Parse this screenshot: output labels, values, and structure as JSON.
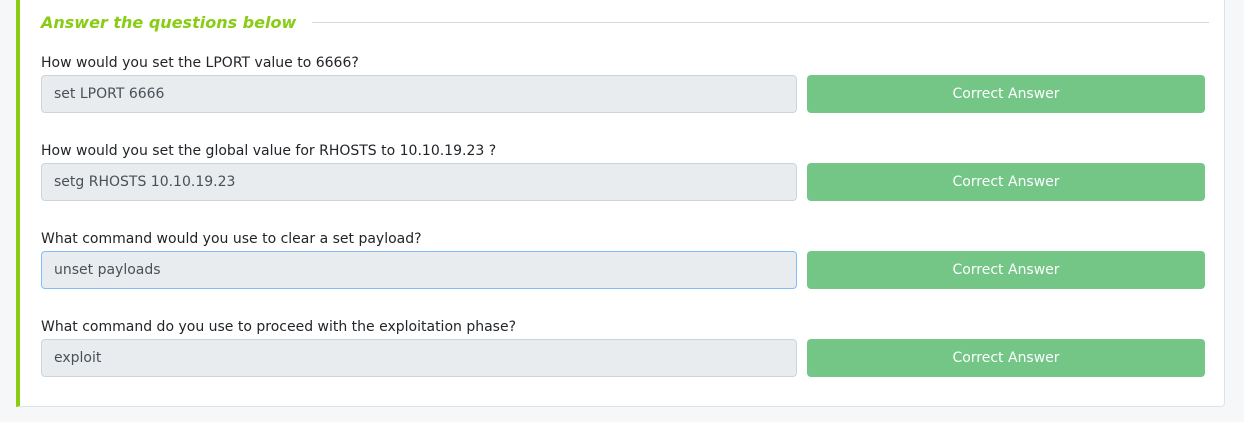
{
  "section": {
    "title": "Answer the questions below"
  },
  "questions": [
    {
      "text": "How would you set the LPORT value to 6666?",
      "answer": "set LPORT 6666",
      "button_label": "Correct Answer"
    },
    {
      "text": "How would you set the global value for RHOSTS  to 10.10.19.23 ?",
      "answer": "setg RHOSTS 10.10.19.23",
      "button_label": "Correct Answer"
    },
    {
      "text": "What command would you use to clear a set payload?",
      "answer": "unset payloads",
      "button_label": "Correct Answer"
    },
    {
      "text": "What command do you use to proceed with the exploitation phase?",
      "answer": "exploit",
      "button_label": "Correct Answer"
    }
  ],
  "colors": {
    "accent": "#88cc14",
    "correct_button": "#73c686",
    "input_background": "#e9ecef",
    "focused_border": "#80bdff"
  }
}
